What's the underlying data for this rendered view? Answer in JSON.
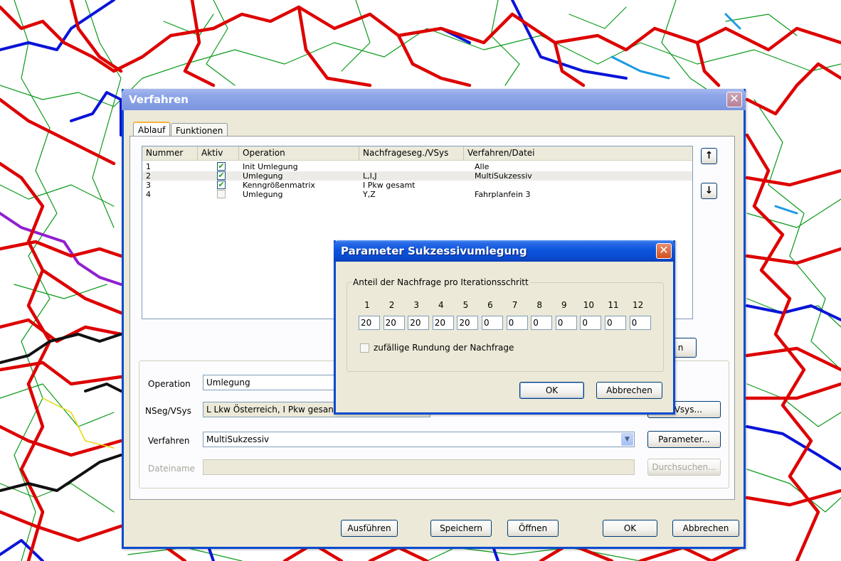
{
  "main_dialog": {
    "title": "Verfahren",
    "tabs": [
      {
        "label": "Ablauf",
        "active": true
      },
      {
        "label": "Funktionen",
        "active": false
      }
    ],
    "list": {
      "columns": [
        "Nummer",
        "Aktiv",
        "Operation",
        "Nachfrageseg./VSys",
        "Verfahren/Datei"
      ],
      "rows": [
        {
          "nummer": "1",
          "aktiv": true,
          "operation": "Init Umlegung",
          "nseg": "",
          "verfahren": "Alle"
        },
        {
          "nummer": "2",
          "aktiv": true,
          "operation": "Umlegung",
          "nseg": "L,I,J",
          "verfahren": "MultiSukzessiv"
        },
        {
          "nummer": "3",
          "aktiv": true,
          "operation": "Kenngrößenmatrix",
          "nseg": "I Pkw gesamt",
          "verfahren": ""
        },
        {
          "nummer": "4",
          "aktiv": false,
          "operation": "Umlegung",
          "nseg": "Y,Z",
          "verfahren": "Fahrplanfein 3"
        }
      ]
    },
    "partial_button_label": "n",
    "form": {
      "operation_label": "Operation",
      "operation_value": "Umlegung",
      "nseg_label": "NSeg/VSys",
      "nseg_value": "L Lkw Österreich, I Pkw gesan",
      "nseg_button": "g/Vsys...",
      "verfahren_label": "Verfahren",
      "verfahren_value": "MultiSukzessiv",
      "parameter_button": "Parameter...",
      "dateiname_label": "Dateiname",
      "dateiname_value": "",
      "durchsuchen_button": "Durchsuchen..."
    },
    "buttons": {
      "ausfuehren": "Ausführen",
      "speichern": "Speichern",
      "oeffnen": "Öffnen",
      "ok": "OK",
      "abbrechen": "Abbrechen"
    }
  },
  "param_dialog": {
    "title": "Parameter Sukzessivumlegung",
    "group_title": "Anteil der Nachfrage pro Iterationsschritt",
    "steps": [
      "1",
      "2",
      "3",
      "4",
      "5",
      "6",
      "7",
      "8",
      "9",
      "10",
      "11",
      "12"
    ],
    "values": [
      "20",
      "20",
      "20",
      "20",
      "20",
      "0",
      "0",
      "0",
      "0",
      "0",
      "0",
      "0"
    ],
    "checkbox_label": "zufällige Rundung der Nachfrage",
    "checkbox_checked": false,
    "ok_label": "OK",
    "cancel_label": "Abbrechen"
  },
  "colors": {
    "road_major": "#e00000",
    "road_motorway": "#0000e0",
    "road_minor": "#00a000",
    "road_secondary": "#00a0e0",
    "road_special": "#9020d0",
    "road_black": "#111111"
  }
}
